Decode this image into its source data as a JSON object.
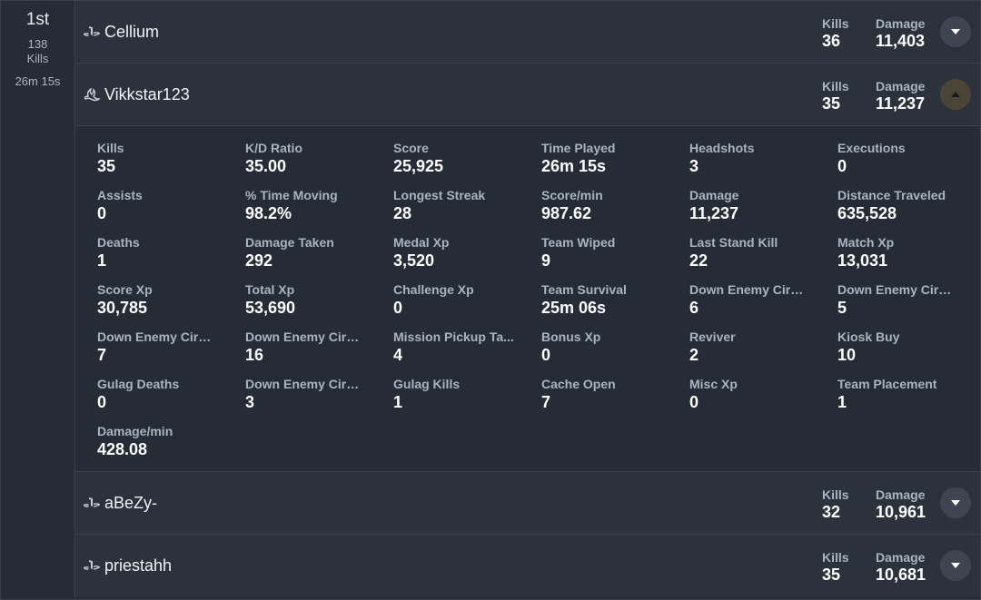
{
  "team": {
    "place": "1st",
    "kills_count": "138",
    "kills_label": "Kills",
    "time": "26m 15s"
  },
  "labels": {
    "kills": "Kills",
    "damage": "Damage"
  },
  "players": [
    {
      "name": "Cellium",
      "platform_icon": "playstation-icon",
      "kills": "36",
      "damage": "11,403",
      "expanded": false
    },
    {
      "name": "Vikkstar123",
      "platform_icon": "battlenet-icon",
      "kills": "35",
      "damage": "11,237",
      "expanded": true
    },
    {
      "name": "aBeZy-",
      "platform_icon": "playstation-icon",
      "kills": "32",
      "damage": "10,961",
      "expanded": false
    },
    {
      "name": "priestahh",
      "platform_icon": "playstation-icon",
      "kills": "35",
      "damage": "10,681",
      "expanded": false
    }
  ],
  "details": [
    {
      "label": "Kills",
      "value": "35"
    },
    {
      "label": "K/D Ratio",
      "value": "35.00"
    },
    {
      "label": "Score",
      "value": "25,925"
    },
    {
      "label": "Time Played",
      "value": "26m 15s"
    },
    {
      "label": "Headshots",
      "value": "3"
    },
    {
      "label": "Executions",
      "value": "0"
    },
    {
      "label": "Assists",
      "value": "0"
    },
    {
      "label": "% Time Moving",
      "value": "98.2%"
    },
    {
      "label": "Longest Streak",
      "value": "28"
    },
    {
      "label": "Score/min",
      "value": "987.62"
    },
    {
      "label": "Damage",
      "value": "11,237"
    },
    {
      "label": "Distance Traveled",
      "value": "635,528"
    },
    {
      "label": "Deaths",
      "value": "1"
    },
    {
      "label": "Damage Taken",
      "value": "292"
    },
    {
      "label": "Medal Xp",
      "value": "3,520"
    },
    {
      "label": "Team Wiped",
      "value": "9"
    },
    {
      "label": "Last Stand Kill",
      "value": "22"
    },
    {
      "label": "Match Xp",
      "value": "13,031"
    },
    {
      "label": "Score Xp",
      "value": "30,785"
    },
    {
      "label": "Total Xp",
      "value": "53,690"
    },
    {
      "label": "Challenge Xp",
      "value": "0"
    },
    {
      "label": "Team Survival",
      "value": "25m 06s"
    },
    {
      "label": "Down Enemy Circle...",
      "value": "6"
    },
    {
      "label": "Down Enemy Circle...",
      "value": "5"
    },
    {
      "label": "Down Enemy Circle...",
      "value": "7"
    },
    {
      "label": "Down Enemy Circle...",
      "value": "16"
    },
    {
      "label": "Mission Pickup Ta...",
      "value": "4"
    },
    {
      "label": "Bonus Xp",
      "value": "0"
    },
    {
      "label": "Reviver",
      "value": "2"
    },
    {
      "label": "Kiosk Buy",
      "value": "10"
    },
    {
      "label": "Gulag Deaths",
      "value": "0"
    },
    {
      "label": "Down Enemy Circle...",
      "value": "3"
    },
    {
      "label": "Gulag Kills",
      "value": "1"
    },
    {
      "label": "Cache Open",
      "value": "7"
    },
    {
      "label": "Misc Xp",
      "value": "0"
    },
    {
      "label": "Team Placement",
      "value": "1"
    },
    {
      "label": "Damage/min",
      "value": "428.08"
    }
  ]
}
